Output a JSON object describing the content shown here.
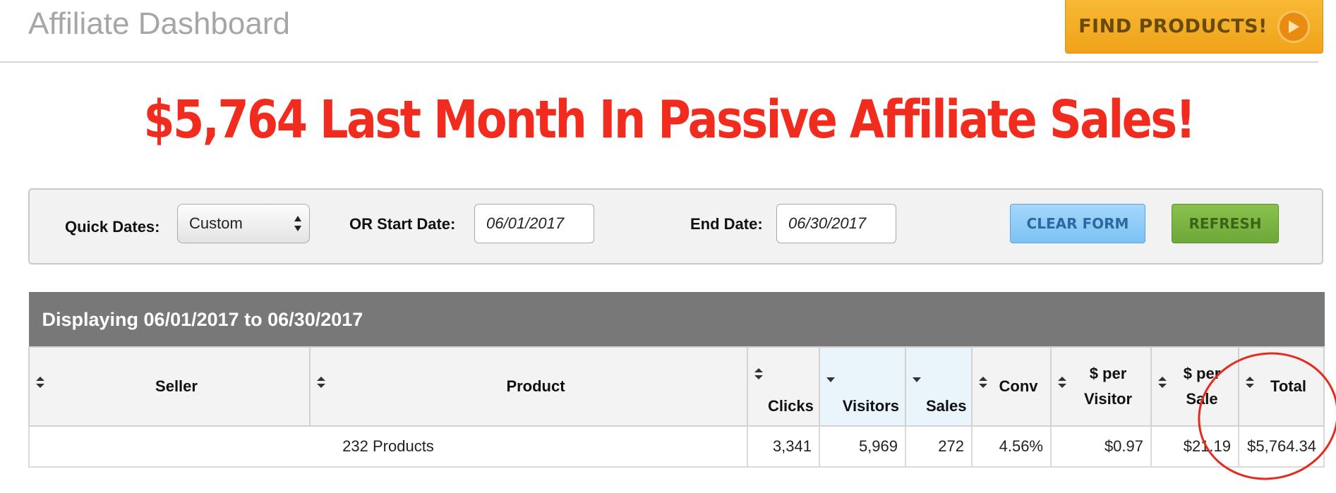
{
  "header": {
    "title": "Affiliate Dashboard",
    "find_products_label": "FIND PRODUCTS!"
  },
  "headline": "$5,764 Last Month In Passive Affiliate Sales!",
  "filters": {
    "quick_dates_label": "Quick Dates:",
    "quick_dates_value": "Custom",
    "start_label": "OR  Start Date:",
    "start_value": "06/01/2017",
    "end_label": "End Date:",
    "end_value": "06/30/2017",
    "clear_label": "CLEAR FORM",
    "refresh_label": "REFRESH"
  },
  "table": {
    "caption": "Displaying 06/01/2017 to 06/30/2017",
    "columns": {
      "seller": "Seller",
      "product": "Product",
      "clicks": "Clicks",
      "visitors": "Visitors",
      "sales": "Sales",
      "conv": "Conv",
      "per_visitor_1": "$ per",
      "per_visitor_2": "Visitor",
      "per_sale_1": "$ per",
      "per_sale_2": "Sale",
      "total": "Total"
    },
    "row": {
      "products": "232 Products",
      "clicks": "3,341",
      "visitors": "5,969",
      "sales": "272",
      "conv": "4.56%",
      "per_visitor": "$0.97",
      "per_sale": "$21.19",
      "total": "$5,764.34"
    }
  },
  "colors": {
    "headline": "#f12b1d",
    "find_button": "#f0a21a",
    "clear_button": "#7cc1f3",
    "refresh_button": "#6ea83a",
    "caption_bar": "#787878",
    "annotation": "#e52a1f"
  },
  "icons": [
    "play-icon",
    "select-arrows-icon",
    "sort-icon",
    "sort-desc-icon"
  ]
}
